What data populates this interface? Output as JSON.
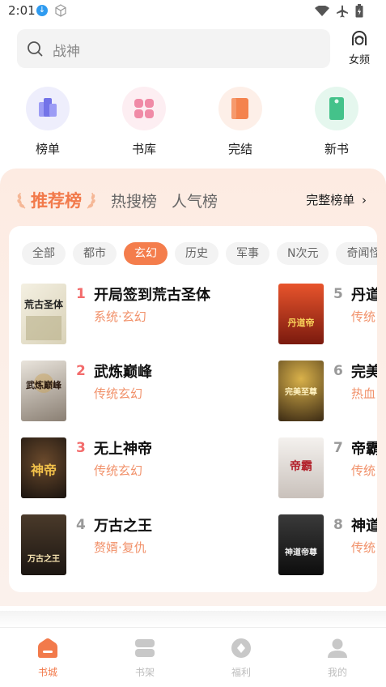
{
  "status": {
    "time": "2:01"
  },
  "search": {
    "placeholder": "战神",
    "female_label": "女频"
  },
  "quick_nav": [
    {
      "label": "榜单",
      "icon": "rank-list-icon",
      "color": "#7f7ff0"
    },
    {
      "label": "书库",
      "icon": "library-icon",
      "color": "#ef7a9c"
    },
    {
      "label": "完结",
      "icon": "finished-book-icon",
      "color": "#f4834e"
    },
    {
      "label": "新书",
      "icon": "new-book-tag-icon",
      "color": "#44c28a"
    }
  ],
  "rank": {
    "tabs": [
      "推荐榜",
      "热搜榜",
      "人气榜"
    ],
    "full_list": "完整榜单",
    "chips": [
      "全部",
      "都市",
      "玄幻",
      "历史",
      "军事",
      "N次元",
      "奇闻怪"
    ],
    "active_chip": "玄幻",
    "books": [
      {
        "rank": "1",
        "title": "开局签到荒古圣体",
        "tag": "系统·玄幻",
        "cover_text": "荒古圣体"
      },
      {
        "rank": "2",
        "title": "武炼巅峰",
        "tag": "传统玄幻",
        "cover_text": "武炼巅峰"
      },
      {
        "rank": "3",
        "title": "无上神帝",
        "tag": "传统玄幻",
        "cover_text": "神帝"
      },
      {
        "rank": "4",
        "title": "万古之王",
        "tag": "赘婿·复仇",
        "cover_text": "万古之王"
      },
      {
        "rank": "5",
        "title": "丹道",
        "tag": "传统",
        "cover_text": "丹道帝"
      },
      {
        "rank": "6",
        "title": "完美",
        "tag": "热血",
        "cover_text": "完美至尊"
      },
      {
        "rank": "7",
        "title": "帝霸",
        "tag": "传统",
        "cover_text": "帝霸"
      },
      {
        "rank": "8",
        "title": "神道",
        "tag": "传统",
        "cover_text": "神道帝尊"
      }
    ]
  },
  "bottom_nav": [
    {
      "label": "书城",
      "active": true
    },
    {
      "label": "书架",
      "active": false
    },
    {
      "label": "福利",
      "active": false
    },
    {
      "label": "我的",
      "active": false
    }
  ],
  "colors": {
    "accent": "#f27a4b",
    "rank_top": "#f36c6c",
    "rank_other": "#999999",
    "tag": "#f1916a"
  }
}
